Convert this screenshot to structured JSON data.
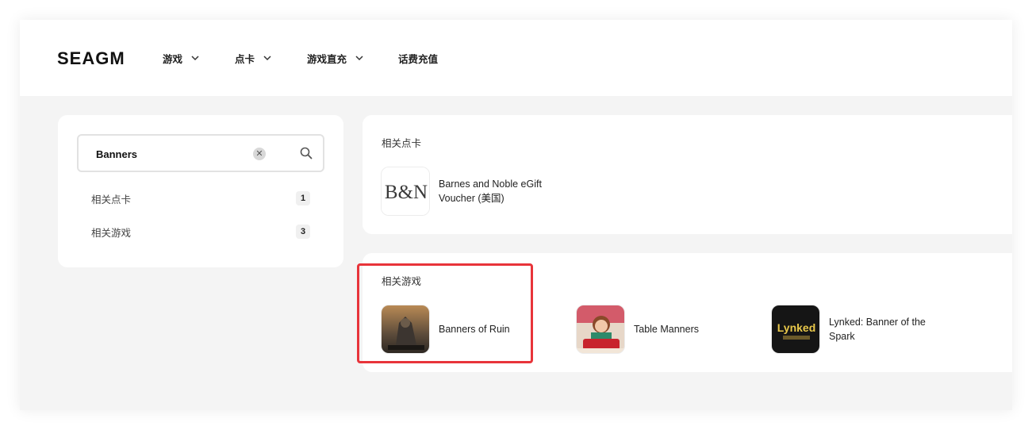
{
  "brand": {
    "logo_text": "SEAGM"
  },
  "nav": [
    {
      "label": "游戏",
      "has_dropdown": true
    },
    {
      "label": "点卡",
      "has_dropdown": true
    },
    {
      "label": "游戏直充",
      "has_dropdown": true
    },
    {
      "label": "话费充值",
      "has_dropdown": false
    }
  ],
  "search": {
    "value": "Banners",
    "clear_icon": "close-icon",
    "search_icon": "search-icon"
  },
  "filters": [
    {
      "label": "相关点卡",
      "count": "1"
    },
    {
      "label": "相关游戏",
      "count": "3"
    }
  ],
  "cards_section": {
    "title": "相关点卡",
    "items": [
      {
        "name": "Barnes and Noble eGift Voucher (美国)",
        "thumb_text": "B&N"
      }
    ]
  },
  "games_section": {
    "title": "相关游戏",
    "items": [
      {
        "name": "Banners of Ruin"
      },
      {
        "name": "Table Manners"
      },
      {
        "name": "Lynked: Banner of the Spark",
        "thumb_text": "Lynked"
      }
    ]
  },
  "colors": {
    "highlight": "#e8343a",
    "page_bg": "#f4f4f4",
    "card_bg": "#ffffff"
  }
}
